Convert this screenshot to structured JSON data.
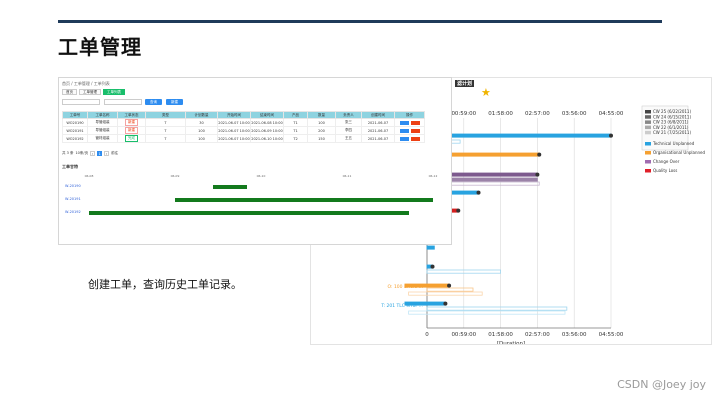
{
  "title": "工单管理",
  "caption": "创建工单，查询历史工单记录。",
  "watermark": "CSDN @Joey joy",
  "left_app": {
    "breadcrumb": "首页 / 工单管理 / 工单列表",
    "tabs": [
      "首页",
      "工单管理",
      "工单列表"
    ],
    "search_label": "查询",
    "new_label": "新建",
    "columns": [
      "工单号",
      "工单名称",
      "工单状态",
      "类型",
      "计划数量",
      "开始时间",
      "结束时间",
      "产品",
      "数量",
      "负责人",
      "创建时间",
      "操作"
    ],
    "rows": [
      [
        "WO20190",
        "导管组装",
        "新建",
        "T",
        "30",
        "2021-06-07 10:00",
        "2021-06-08 10:00",
        "T1",
        "100",
        "张三",
        "2021-06-07",
        "编辑删除"
      ],
      [
        "WO20191",
        "导管组装",
        "新建",
        "T",
        "100",
        "2021-06-07 10:00",
        "2021-06-09 10:00",
        "T1",
        "200",
        "李四",
        "2021-06-07",
        "编辑删除"
      ],
      [
        "WO20192",
        "管材组装",
        "完成",
        "T",
        "100",
        "2021-06-07 10:00",
        "2021-06-10 10:00",
        "T2",
        "150",
        "王五",
        "2021-06-07",
        "编辑删除"
      ]
    ],
    "pager": {
      "total_label": "共 3 条",
      "page_size": "10条/页",
      "page": "1",
      "goto_label": "前往"
    },
    "gantt_title": "工单甘特",
    "gantt_ticks": [
      "06-08",
      "06-09",
      "06-10",
      "06-11",
      "06-12"
    ],
    "gantt_rows": [
      {
        "label": "W-20190",
        "start": 0.36,
        "end": 0.46
      },
      {
        "label": "W-20191",
        "start": 0.25,
        "end": 1.0
      },
      {
        "label": "W-20192",
        "start": 0.0,
        "end": 0.93
      }
    ]
  },
  "gantt_chart": {
    "filter_label": "滤计划",
    "x_ticks": [
      "0",
      "00:59:00",
      "01:58:00",
      "02:57:00",
      "03:56:00",
      "04:55:00"
    ],
    "x_label": "[Duration]",
    "row_labels": [
      "O: 100 Errors ...",
      "T: 201 TLC error ..."
    ],
    "legend": [
      {
        "label": "CW 25 (6/22/2011)",
        "color": "#444444"
      },
      {
        "label": "CW 24 (6/15/2011)",
        "color": "#666666"
      },
      {
        "label": "CW 23 (6/8/2011)",
        "color": "#888888"
      },
      {
        "label": "CW 22 (6/1/2011)",
        "color": "#aaaaaa"
      },
      {
        "label": "CW 21 (7/25/2011)",
        "color": "#cccccc"
      },
      {
        "label": "Technical Unplanned",
        "color": "#29a3e0"
      },
      {
        "label": "Organisational Unplanned",
        "color": "#f5a031"
      },
      {
        "label": "Change Over",
        "color": "#a06cb0"
      },
      {
        "label": "Quality Loss",
        "color": "#e0202a"
      }
    ],
    "accent_blue": "#29a3e0",
    "accent_orange": "#f5a031",
    "accent_purple": "#7d5a8e",
    "accent_red": "#d42020"
  }
}
